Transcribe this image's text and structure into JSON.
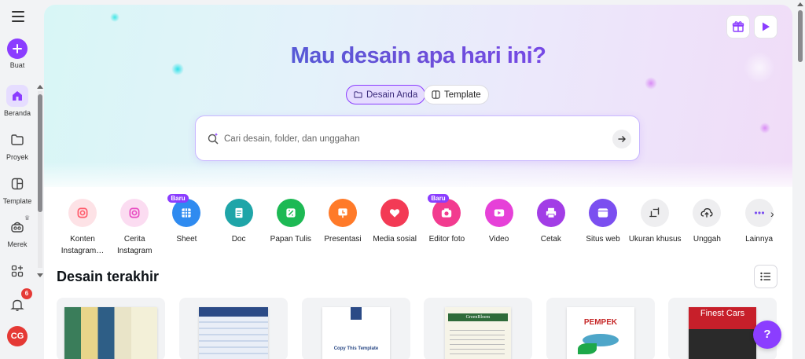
{
  "sidebar": {
    "create_label": "Buat",
    "items": [
      {
        "label": "Beranda",
        "icon": "home-icon"
      },
      {
        "label": "Proyek",
        "icon": "folder-icon"
      },
      {
        "label": "Template",
        "icon": "template-icon"
      },
      {
        "label": "Merek",
        "icon": "brand-icon"
      },
      {
        "label": "",
        "icon": "apps-icon"
      }
    ],
    "notifications_count": "6",
    "avatar_initials": "CG"
  },
  "hero": {
    "title": "Mau desain apa hari ini?",
    "tabs": [
      {
        "label": "Desain Anda",
        "active": true
      },
      {
        "label": "Template",
        "active": false
      }
    ],
    "search_placeholder": "Cari desain, folder, dan unggahan"
  },
  "categories": [
    {
      "label": "Konten Instagram…",
      "color": "#ff5c6c",
      "bg": "#fde2e6",
      "icon": "instagram-post-icon",
      "badge": ""
    },
    {
      "label": "Cerita Instagram",
      "color": "#e84cc2",
      "bg": "#fbdcf1",
      "icon": "instagram-story-icon",
      "badge": ""
    },
    {
      "label": "Sheet",
      "color": "#2f8bf0",
      "bg": "#2f8bf0",
      "icon": "sheet-icon",
      "badge": "Baru"
    },
    {
      "label": "Doc",
      "color": "#1fa5a8",
      "bg": "#1fa5a8",
      "icon": "doc-icon",
      "badge": ""
    },
    {
      "label": "Papan Tulis",
      "color": "#1db954",
      "bg": "#1db954",
      "icon": "whiteboard-icon",
      "badge": ""
    },
    {
      "label": "Presentasi",
      "color": "#ff7a29",
      "bg": "#ff7a29",
      "icon": "presentation-icon",
      "badge": ""
    },
    {
      "label": "Media sosial",
      "color": "#f33a55",
      "bg": "#f33a55",
      "icon": "social-media-icon",
      "badge": ""
    },
    {
      "label": "Editor foto",
      "color": "#f23b8f",
      "bg": "#f23b8f",
      "icon": "photo-editor-icon",
      "badge": "Baru"
    },
    {
      "label": "Video",
      "color": "#e641d8",
      "bg": "#e641d8",
      "icon": "video-icon",
      "badge": ""
    },
    {
      "label": "Cetak",
      "color": "#a23de6",
      "bg": "#a23de6",
      "icon": "print-icon",
      "badge": ""
    },
    {
      "label": "Situs web",
      "color": "#7b4ff0",
      "bg": "#7b4ff0",
      "icon": "website-icon",
      "badge": ""
    },
    {
      "label": "Ukuran khusus",
      "color": "#333",
      "bg": "#eeeef0",
      "icon": "custom-size-icon",
      "badge": ""
    },
    {
      "label": "Unggah",
      "color": "#333",
      "bg": "#eeeef0",
      "icon": "upload-icon",
      "badge": ""
    },
    {
      "label": "Lainnya",
      "color": "#7b4ff0",
      "bg": "#eeeef0",
      "icon": "more-icon",
      "badge": ""
    }
  ],
  "recent": {
    "title": "Desain terakhir",
    "thumbnails": [
      {
        "kind": "brochure",
        "text": ""
      },
      {
        "kind": "table",
        "text": ""
      },
      {
        "kind": "template",
        "text": "Copy This Template"
      },
      {
        "kind": "menu",
        "text": "GreenBloem"
      },
      {
        "kind": "food",
        "text": "PEMPEK"
      },
      {
        "kind": "cars",
        "text": "Finest Cars"
      }
    ]
  },
  "help_label": "?",
  "colors": {
    "accent": "#8b3dff",
    "badge": "#e53935"
  }
}
